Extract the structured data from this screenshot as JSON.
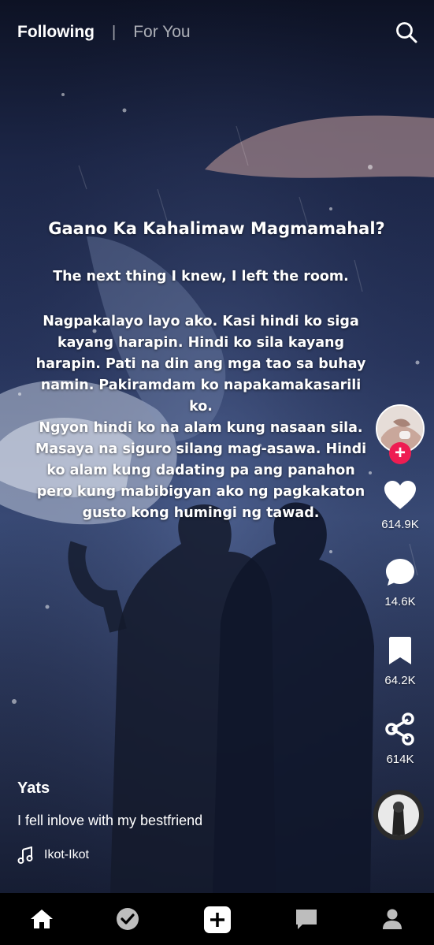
{
  "top_nav": {
    "following": "Following",
    "divider": "|",
    "for_you": "For You"
  },
  "overlay": {
    "title": "Gaano Ka Kahalimaw Magmamahal?",
    "paragraph_1": "The next thing I knew, I left the room.",
    "paragraph_2": "Nagpakalayo layo ako. Kasi hindi ko siga kayang harapin. Hindi ko sila kayang harapin. Pati na din ang mga tao sa buhay namin. Pakiramdam ko napakamakasarili ko.",
    "paragraph_3": "Ngyon hindi ko na alam kung nasaan sila. Masaya na siguro silang mag-asawa. Hindi ko alam kung dadating pa ang panahon pero kung mabibigyan ako ng pagkakaton gusto kong humingi ng tawad."
  },
  "actions": {
    "follow_symbol": "+",
    "likes": "614.9K",
    "comments": "14.6K",
    "saves": "64.2K",
    "shares": "614K"
  },
  "post": {
    "username": "Yats",
    "description": "I fell inlove with my bestfriend",
    "sound": "Ikot-Ikot"
  },
  "bottom_nav": [
    "home-icon",
    "check-icon",
    "create-icon",
    "inbox-icon",
    "profile-icon"
  ],
  "colors": {
    "follow_red": "#ee1d52",
    "bar_bg": "#000000"
  }
}
